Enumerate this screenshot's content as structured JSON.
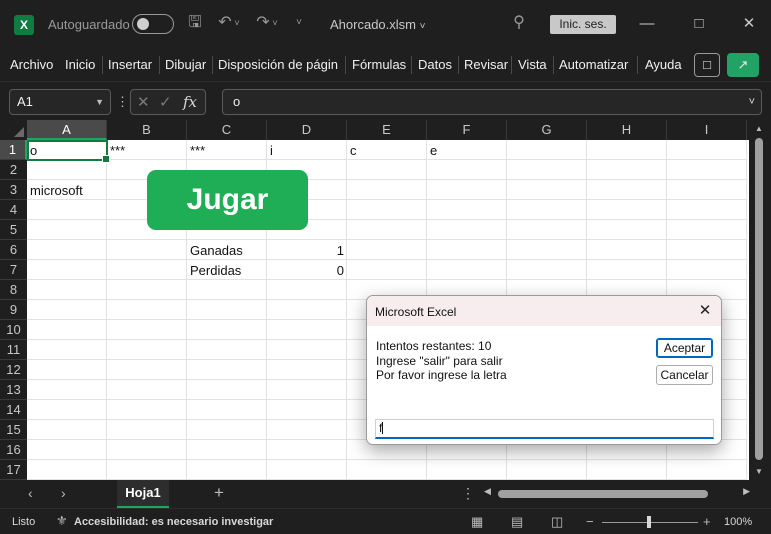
{
  "titlebar": {
    "app_icon": "X",
    "autosave_label": "Autoguardado",
    "filename": "Ahorcado.xlsm",
    "signin_label": "Inic. ses."
  },
  "ribbon": {
    "tabs": [
      "Archivo",
      "Inicio",
      "Insertar",
      "Dibujar",
      "Disposición de págin",
      "Fórmulas",
      "Datos",
      "Revisar",
      "Vista",
      "Automatizar",
      "Ayuda"
    ]
  },
  "formula_bar": {
    "name_box": "A1",
    "content": "o",
    "fx": "fx"
  },
  "grid": {
    "columns": [
      "A",
      "B",
      "C",
      "D",
      "E",
      "F",
      "G",
      "H",
      "I"
    ],
    "rows": [
      "1",
      "2",
      "3",
      "4",
      "5",
      "6",
      "7",
      "8",
      "9",
      "10",
      "11",
      "12",
      "13",
      "14",
      "15",
      "16",
      "17"
    ],
    "cells": {
      "A1": "o",
      "B1": "***",
      "C1": "***",
      "D1": "i",
      "E1": "c",
      "F1": "e",
      "A3": "microsoft",
      "C6": "Ganadas",
      "D6": "1",
      "C7": "Perdidas",
      "D7": "0"
    },
    "jugar_label": "Jugar"
  },
  "sheet_tabs": {
    "active": "Hoja1",
    "add": "+"
  },
  "statusbar": {
    "ready": "Listo",
    "accessibility": "Accesibilidad: es necesario investigar",
    "zoom": "100%",
    "zoom_level": 1.0
  },
  "dialog": {
    "title": "Microsoft Excel",
    "line1": "Intentos restantes: 10",
    "line2": "Ingrese \"salir\" para salir",
    "line3": "Por favor ingrese la letra",
    "ok_label": "Aceptar",
    "cancel_label": "Cancelar",
    "input_value": "f"
  },
  "colors": {
    "accent": "#107c41",
    "button_green": "#1fae55",
    "dialog_focus": "#0067c0"
  }
}
